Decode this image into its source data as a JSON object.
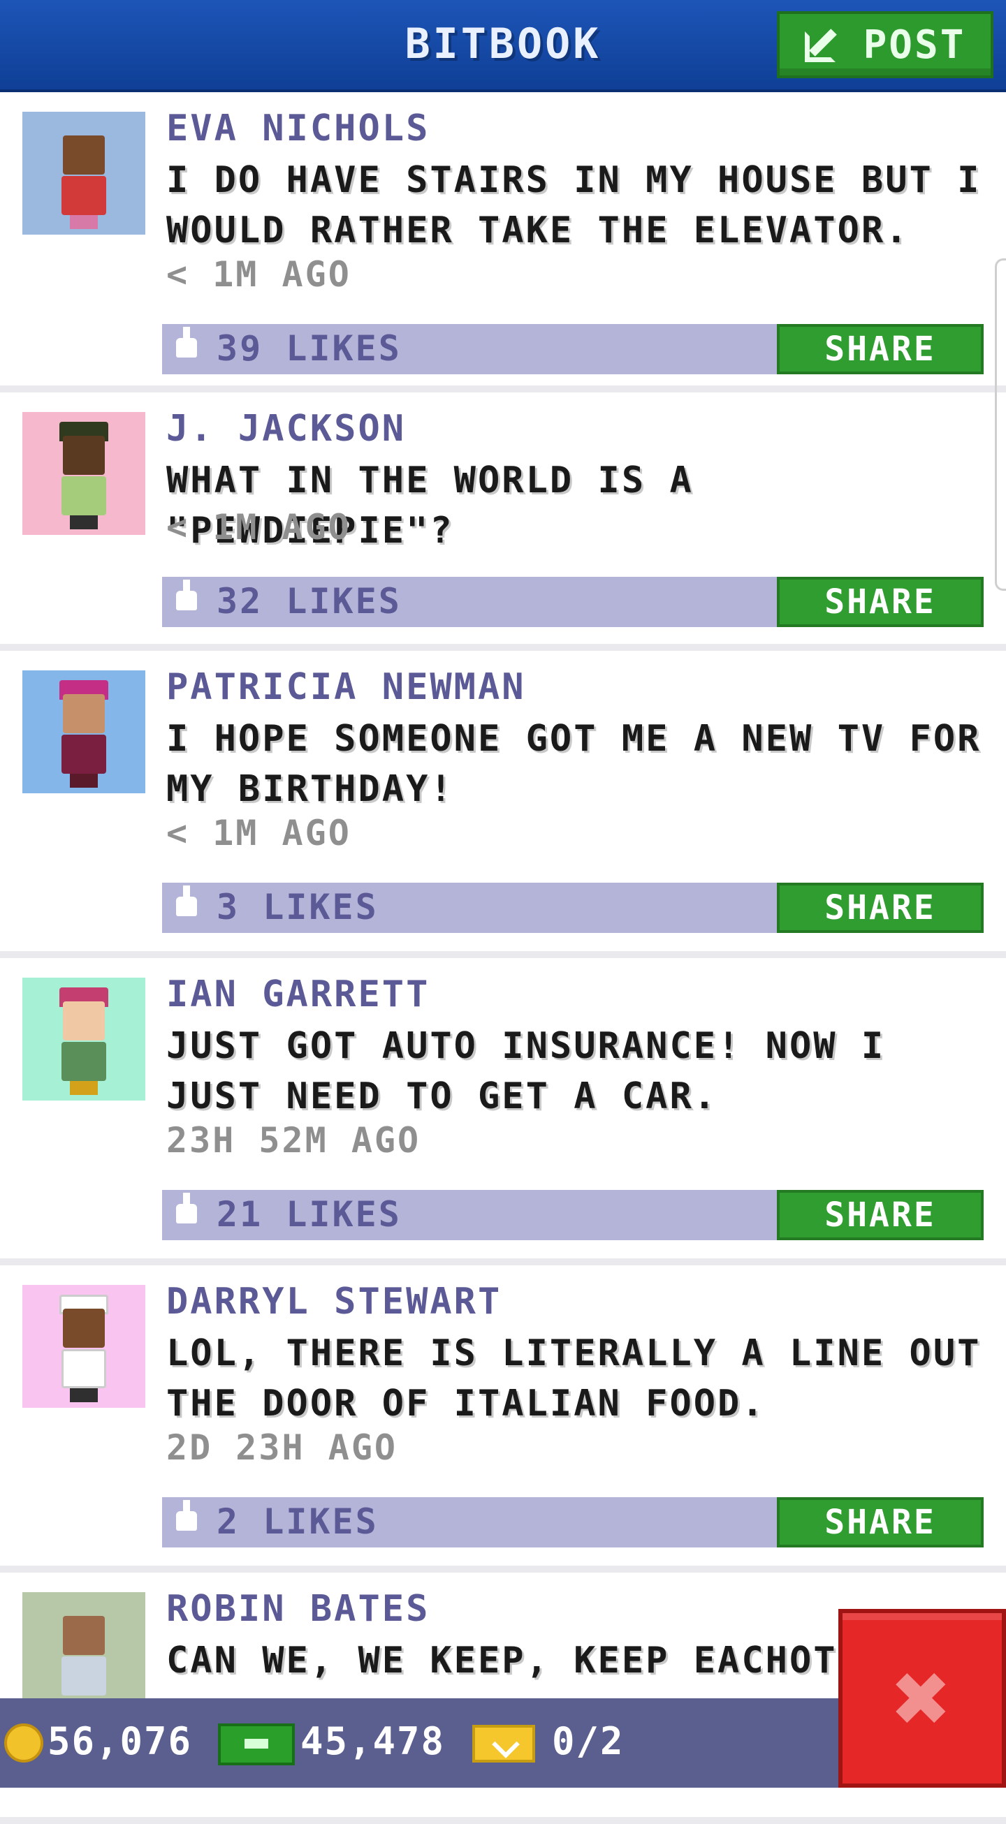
{
  "header": {
    "title": "BITBOOK",
    "post_label": "POST"
  },
  "posts": [
    {
      "name": "EVA NICHOLS",
      "message": "I DO HAVE STAIRS IN MY HOUSE BUT I WOULD RATHER TAKE THE ELEVATOR.",
      "time": "< 1M AGO",
      "likes": "39 LIKES",
      "share": "SHARE",
      "avatar_bg": "#9bb8df",
      "skin": "#7a4b2b",
      "shirt": "#d23a3a",
      "hat": ""
    },
    {
      "name": "J. JACKSON",
      "message": "WHAT IN THE WORLD IS A \"PEWDIEPIE\"?",
      "time": "< 1M AGO",
      "likes": "32 LIKES",
      "share": "SHARE",
      "avatar_bg": "#f6b8cc",
      "skin": "#5a3b22",
      "shirt": "#a4cc7a",
      "hat": "#2f3a1f"
    },
    {
      "name": "PATRICIA NEWMAN",
      "message": "I HOPE SOMEONE GOT ME A NEW TV FOR MY BIRTHDAY!",
      "time": "< 1M AGO",
      "likes": "3 LIKES",
      "share": "SHARE",
      "avatar_bg": "#85b6ea",
      "skin": "#c6906b",
      "shirt": "#7a1f3f",
      "hat": "#c42e85"
    },
    {
      "name": "IAN GARRETT",
      "message": "JUST GOT AUTO INSURANCE! NOW I JUST NEED TO GET A CAR.",
      "time": "23H 52M AGO",
      "likes": "21 LIKES",
      "share": "SHARE",
      "avatar_bg": "#a6f0d6",
      "skin": "#f0c9a4",
      "shirt": "#5a8f5a",
      "hat": "#c43f6f"
    },
    {
      "name": "DARRYL STEWART",
      "message": "LOL, THERE IS LITERALLY A LINE OUT THE DOOR OF ITALIAN FOOD.",
      "time": "2D 23H AGO",
      "likes": "2 LIKES",
      "share": "SHARE",
      "avatar_bg": "#f9c4ef",
      "skin": "#7a4b2b",
      "shirt": "#ffffff",
      "hat": "#ffffff"
    },
    {
      "name": "ROBIN BATES",
      "message": "CAN WE, WE KEEP, KEEP EACHOT",
      "avatar_bg": "#b7c8a8",
      "skin": "#9a6a4b",
      "shirt": "#c9d4e0",
      "hat": ""
    }
  ],
  "bottom": {
    "coins": "56,076",
    "cash": "45,478",
    "tickets": "0/2"
  },
  "icons": {
    "post": "compose-icon",
    "like": "thumbs-up-icon",
    "coin": "coin-icon",
    "cash": "cash-icon",
    "ticket": "ticket-icon",
    "close": "close-icon"
  },
  "colors": {
    "header": "#1d55b7",
    "accent_green": "#2f9d2f",
    "likes_bar": "#b3b4d8",
    "name_text": "#5c5a96",
    "close_red": "#e62727",
    "bottom_bar": "#5a5f8f"
  }
}
